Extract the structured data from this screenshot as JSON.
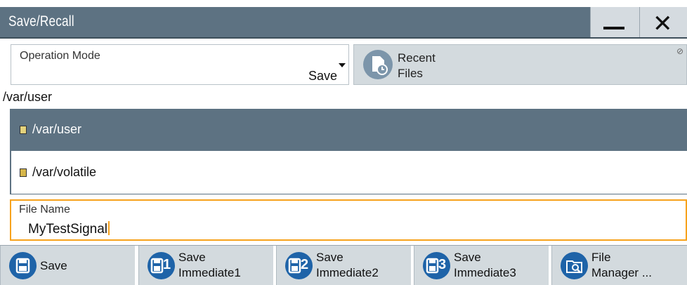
{
  "window": {
    "title": "Save/Recall",
    "minimize_icon": "minimize-icon",
    "close_icon": "close-icon"
  },
  "operation_mode": {
    "label": "Operation Mode",
    "value": "Save"
  },
  "recent_files": {
    "label_line1": "Recent",
    "label_line2": "Files",
    "icon": "recent-files-icon"
  },
  "current_path": "/var/user",
  "directories": [
    {
      "name": "/var/user",
      "selected": true
    },
    {
      "name": "/var/volatile",
      "selected": false
    }
  ],
  "file_name": {
    "label": "File Name",
    "value": "MyTestSignal"
  },
  "buttons": [
    {
      "line1": "Save",
      "line2": "",
      "icon": "save-icon",
      "num": ""
    },
    {
      "line1": "Save",
      "line2": "Immediate1",
      "icon": "save-immediate-icon",
      "num": "1"
    },
    {
      "line1": "Save",
      "line2": "Immediate2",
      "icon": "save-immediate-icon",
      "num": "2"
    },
    {
      "line1": "Save",
      "line2": "Immediate3",
      "icon": "save-immediate-icon",
      "num": "3"
    },
    {
      "line1": "File",
      "line2": "Manager ...",
      "icon": "file-manager-icon",
      "num": ""
    }
  ],
  "colors": {
    "titlebar": "#5d7282",
    "selection": "#5d7282",
    "focus_border": "#f7a21c",
    "button_bg": "#d3dade",
    "icon_blue": "#1e63a8"
  }
}
